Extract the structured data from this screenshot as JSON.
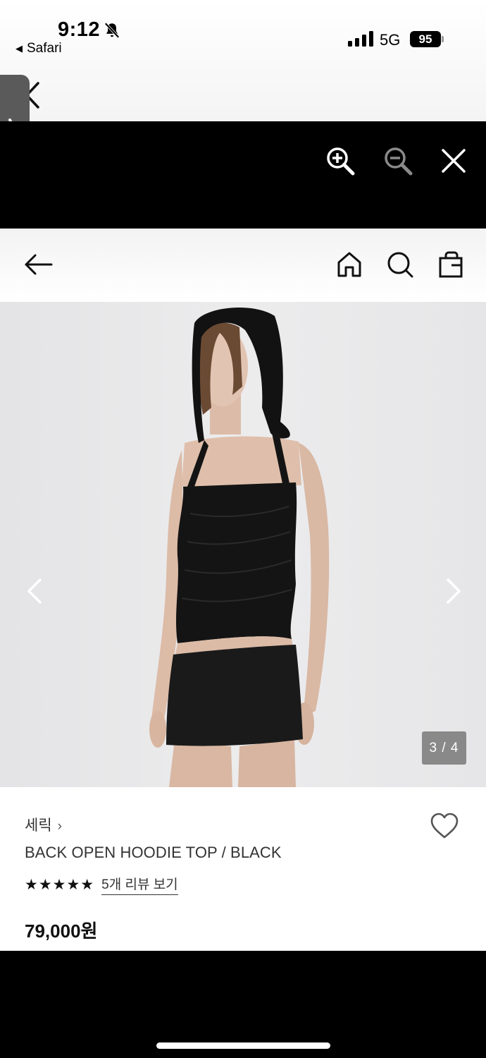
{
  "status_bar": {
    "time": "9:12",
    "back_app": "Safari",
    "network": "5G",
    "battery": "95"
  },
  "viewer_toolbar": {
    "icons": [
      "zoom-in-icon",
      "zoom-out-icon",
      "close-icon"
    ]
  },
  "header": {
    "icons": [
      "back-arrow-icon",
      "home-icon",
      "search-icon",
      "shopping-bag-icon"
    ]
  },
  "gallery": {
    "counter": "3 / 4"
  },
  "product": {
    "brand": "세릭",
    "brand_chevron": "›",
    "name": "BACK OPEN HOODIE TOP / BLACK",
    "stars": "★★★★★",
    "rating": 5,
    "review_link": "5개 리뷰 보기",
    "price": "79,000원"
  },
  "colors": {
    "toolbar_bg": "#000000",
    "image_bg": "#e9e9ea",
    "text_primary": "#333333"
  }
}
